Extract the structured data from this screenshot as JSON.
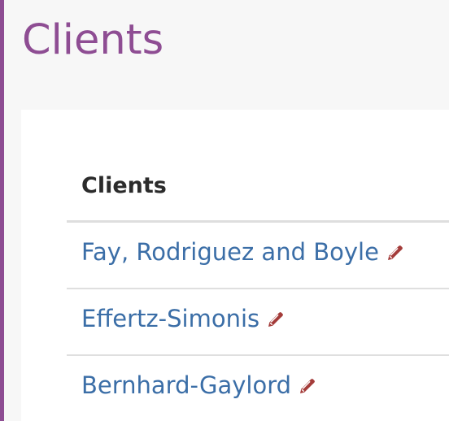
{
  "app": {
    "title": "Clients"
  },
  "table": {
    "header": "Clients",
    "rows": [
      {
        "name": "Fay, Rodriguez and Boyle",
        "icon": "pencil-icon"
      },
      {
        "name": "Effertz-Simonis",
        "icon": "pencil-icon"
      },
      {
        "name": "Bernhard-Gaylord",
        "icon": "pencil-icon"
      }
    ]
  },
  "colors": {
    "accent": "#8e4d93",
    "link": "#3b6ea7",
    "edit_icon": "#a43c3a"
  }
}
